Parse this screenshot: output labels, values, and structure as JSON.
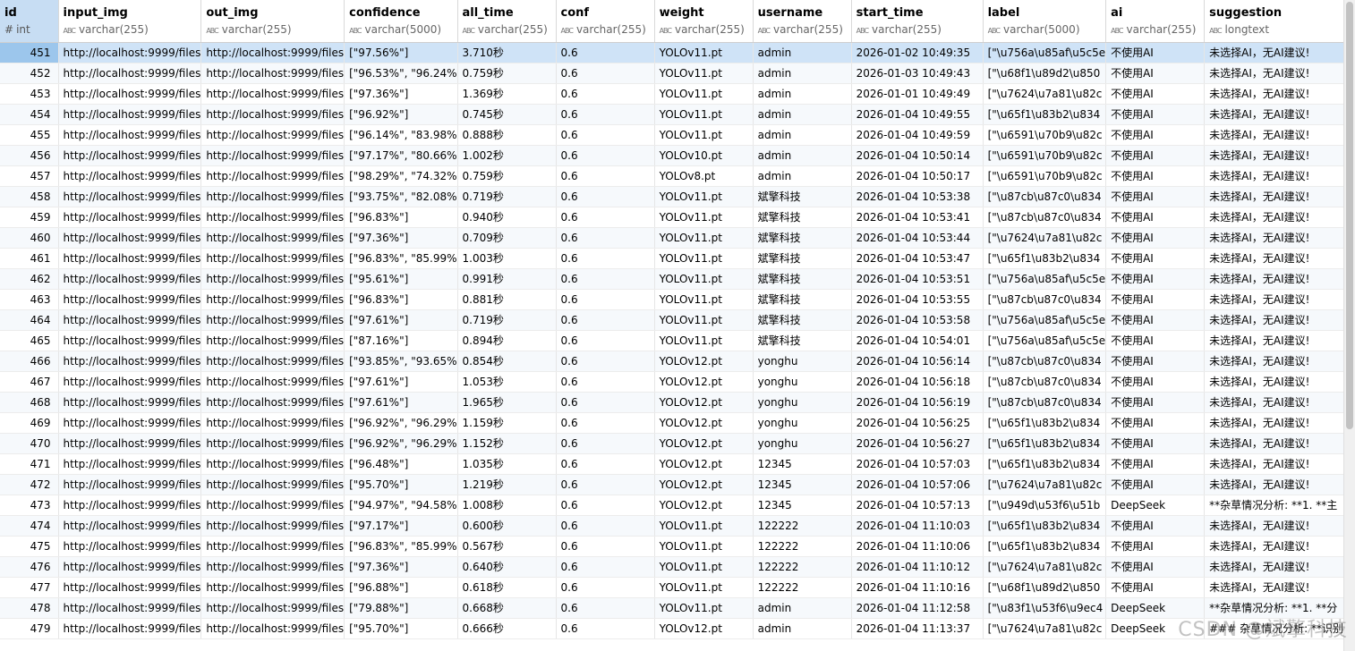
{
  "columns": [
    {
      "name": "id",
      "type": "int",
      "icon": "#",
      "width": 72
    },
    {
      "name": "input_img",
      "type": "varchar(255)",
      "icon": "ABC",
      "width": 151
    },
    {
      "name": "out_img",
      "type": "varchar(255)",
      "icon": "ABC",
      "width": 151
    },
    {
      "name": "confidence",
      "type": "varchar(5000)",
      "icon": "ABC",
      "width": 118
    },
    {
      "name": "all_time",
      "type": "varchar(255)",
      "icon": "ABC",
      "width": 112
    },
    {
      "name": "conf",
      "type": "varchar(255)",
      "icon": "ABC",
      "width": 112
    },
    {
      "name": "weight",
      "type": "varchar(255)",
      "icon": "ABC",
      "width": 112
    },
    {
      "name": "username",
      "type": "varchar(255)",
      "icon": "ABC",
      "width": 112
    },
    {
      "name": "start_time",
      "type": "varchar(255)",
      "icon": "ABC",
      "width": 150
    },
    {
      "name": "label",
      "type": "varchar(5000)",
      "icon": "ABC",
      "width": 130
    },
    {
      "name": "ai",
      "type": "varchar(255)",
      "icon": "ABC",
      "width": 112
    },
    {
      "name": "suggestion",
      "type": "longtext",
      "icon": "ABC",
      "width": 150
    }
  ],
  "rows": [
    [
      "451",
      "http://localhost:9999/files",
      "http://localhost:9999/files",
      "[\"97.56%\"]",
      "3.710秒",
      "0.6",
      "YOLOv11.pt",
      "admin",
      "2026-01-02 10:49:35",
      "[\"\\u756a\\u85af\\u5c5e",
      "不使用AI",
      "未选择AI，无AI建议!"
    ],
    [
      "452",
      "http://localhost:9999/files",
      "http://localhost:9999/files",
      "[\"96.53%\", \"96.24%",
      "0.759秒",
      "0.6",
      "YOLOv11.pt",
      "admin",
      "2026-01-03 10:49:43",
      "[\"\\u68f1\\u89d2\\u850",
      "不使用AI",
      "未选择AI，无AI建议!"
    ],
    [
      "453",
      "http://localhost:9999/files",
      "http://localhost:9999/files",
      "[\"97.36%\"]",
      "1.369秒",
      "0.6",
      "YOLOv11.pt",
      "admin",
      "2026-01-01 10:49:49",
      "[\"\\u7624\\u7a81\\u82c",
      "不使用AI",
      "未选择AI，无AI建议!"
    ],
    [
      "454",
      "http://localhost:9999/files",
      "http://localhost:9999/files",
      "[\"96.92%\"]",
      "0.745秒",
      "0.6",
      "YOLOv11.pt",
      "admin",
      "2026-01-04 10:49:55",
      "[\"\\u65f1\\u83b2\\u834",
      "不使用AI",
      "未选择AI，无AI建议!"
    ],
    [
      "455",
      "http://localhost:9999/files",
      "http://localhost:9999/files",
      "[\"96.14%\", \"83.98%",
      "0.888秒",
      "0.6",
      "YOLOv11.pt",
      "admin",
      "2026-01-04 10:49:59",
      "[\"\\u6591\\u70b9\\u82c",
      "不使用AI",
      "未选择AI，无AI建议!"
    ],
    [
      "456",
      "http://localhost:9999/files",
      "http://localhost:9999/files",
      "[\"97.17%\", \"80.66%",
      "1.002秒",
      "0.6",
      "YOLOv10.pt",
      "admin",
      "2026-01-04 10:50:14",
      "[\"\\u6591\\u70b9\\u82c",
      "不使用AI",
      "未选择AI，无AI建议!"
    ],
    [
      "457",
      "http://localhost:9999/files",
      "http://localhost:9999/files",
      "[\"98.29%\", \"74.32%",
      "0.759秒",
      "0.6",
      "YOLOv8.pt",
      "admin",
      "2026-01-04 10:50:17",
      "[\"\\u6591\\u70b9\\u82c",
      "不使用AI",
      "未选择AI，无AI建议!"
    ],
    [
      "458",
      "http://localhost:9999/files",
      "http://localhost:9999/files",
      "[\"93.75%\", \"82.08%",
      "0.719秒",
      "0.6",
      "YOLOv11.pt",
      "斌擎科技",
      "2026-01-04 10:53:38",
      "[\"\\u87cb\\u87c0\\u834",
      "不使用AI",
      "未选择AI，无AI建议!"
    ],
    [
      "459",
      "http://localhost:9999/files",
      "http://localhost:9999/files",
      "[\"96.83%\"]",
      "0.940秒",
      "0.6",
      "YOLOv11.pt",
      "斌擎科技",
      "2026-01-04 10:53:41",
      "[\"\\u87cb\\u87c0\\u834",
      "不使用AI",
      "未选择AI，无AI建议!"
    ],
    [
      "460",
      "http://localhost:9999/files",
      "http://localhost:9999/files",
      "[\"97.36%\"]",
      "0.709秒",
      "0.6",
      "YOLOv11.pt",
      "斌擎科技",
      "2026-01-04 10:53:44",
      "[\"\\u7624\\u7a81\\u82c",
      "不使用AI",
      "未选择AI，无AI建议!"
    ],
    [
      "461",
      "http://localhost:9999/files",
      "http://localhost:9999/files",
      "[\"96.83%\", \"85.99%",
      "1.003秒",
      "0.6",
      "YOLOv11.pt",
      "斌擎科技",
      "2026-01-04 10:53:47",
      "[\"\\u65f1\\u83b2\\u834",
      "不使用AI",
      "未选择AI，无AI建议!"
    ],
    [
      "462",
      "http://localhost:9999/files",
      "http://localhost:9999/files",
      "[\"95.61%\"]",
      "0.991秒",
      "0.6",
      "YOLOv11.pt",
      "斌擎科技",
      "2026-01-04 10:53:51",
      "[\"\\u756a\\u85af\\u5c5e",
      "不使用AI",
      "未选择AI，无AI建议!"
    ],
    [
      "463",
      "http://localhost:9999/files",
      "http://localhost:9999/files",
      "[\"96.83%\"]",
      "0.881秒",
      "0.6",
      "YOLOv11.pt",
      "斌擎科技",
      "2026-01-04 10:53:55",
      "[\"\\u87cb\\u87c0\\u834",
      "不使用AI",
      "未选择AI，无AI建议!"
    ],
    [
      "464",
      "http://localhost:9999/files",
      "http://localhost:9999/files",
      "[\"97.61%\"]",
      "0.719秒",
      "0.6",
      "YOLOv11.pt",
      "斌擎科技",
      "2026-01-04 10:53:58",
      "[\"\\u756a\\u85af\\u5c5e",
      "不使用AI",
      "未选择AI，无AI建议!"
    ],
    [
      "465",
      "http://localhost:9999/files",
      "http://localhost:9999/files",
      "[\"87.16%\"]",
      "0.894秒",
      "0.6",
      "YOLOv11.pt",
      "斌擎科技",
      "2026-01-04 10:54:01",
      "[\"\\u756a\\u85af\\u5c5e",
      "不使用AI",
      "未选择AI，无AI建议!"
    ],
    [
      "466",
      "http://localhost:9999/files",
      "http://localhost:9999/files",
      "[\"93.85%\", \"93.65%",
      "0.854秒",
      "0.6",
      "YOLOv12.pt",
      "yonghu",
      "2026-01-04 10:56:14",
      "[\"\\u87cb\\u87c0\\u834",
      "不使用AI",
      "未选择AI，无AI建议!"
    ],
    [
      "467",
      "http://localhost:9999/files",
      "http://localhost:9999/files",
      "[\"97.61%\"]",
      "1.053秒",
      "0.6",
      "YOLOv12.pt",
      "yonghu",
      "2026-01-04 10:56:18",
      "[\"\\u87cb\\u87c0\\u834",
      "不使用AI",
      "未选择AI，无AI建议!"
    ],
    [
      "468",
      "http://localhost:9999/files",
      "http://localhost:9999/files",
      "[\"97.61%\"]",
      "1.965秒",
      "0.6",
      "YOLOv12.pt",
      "yonghu",
      "2026-01-04 10:56:19",
      "[\"\\u87cb\\u87c0\\u834",
      "不使用AI",
      "未选择AI，无AI建议!"
    ],
    [
      "469",
      "http://localhost:9999/files",
      "http://localhost:9999/files",
      "[\"96.92%\", \"96.29%",
      "1.159秒",
      "0.6",
      "YOLOv12.pt",
      "yonghu",
      "2026-01-04 10:56:25",
      "[\"\\u65f1\\u83b2\\u834",
      "不使用AI",
      "未选择AI，无AI建议!"
    ],
    [
      "470",
      "http://localhost:9999/files",
      "http://localhost:9999/files",
      "[\"96.92%\", \"96.29%",
      "1.152秒",
      "0.6",
      "YOLOv12.pt",
      "yonghu",
      "2026-01-04 10:56:27",
      "[\"\\u65f1\\u83b2\\u834",
      "不使用AI",
      "未选择AI，无AI建议!"
    ],
    [
      "471",
      "http://localhost:9999/files",
      "http://localhost:9999/files",
      "[\"96.48%\"]",
      "1.035秒",
      "0.6",
      "YOLOv12.pt",
      "12345",
      "2026-01-04 10:57:03",
      "[\"\\u65f1\\u83b2\\u834",
      "不使用AI",
      "未选择AI，无AI建议!"
    ],
    [
      "472",
      "http://localhost:9999/files",
      "http://localhost:9999/files",
      "[\"95.70%\"]",
      "1.219秒",
      "0.6",
      "YOLOv12.pt",
      "12345",
      "2026-01-04 10:57:06",
      "[\"\\u7624\\u7a81\\u82c",
      "不使用AI",
      "未选择AI，无AI建议!"
    ],
    [
      "473",
      "http://localhost:9999/files",
      "http://localhost:9999/files",
      "[\"94.97%\", \"94.58%",
      "1.008秒",
      "0.6",
      "YOLOv12.pt",
      "12345",
      "2026-01-04 10:57:13",
      "[\"\\u949d\\u53f6\\u51b",
      "DeepSeek",
      "**杂草情况分析: **1. **主"
    ],
    [
      "474",
      "http://localhost:9999/files",
      "http://localhost:9999/files",
      "[\"97.17%\"]",
      "0.600秒",
      "0.6",
      "YOLOv11.pt",
      "122222",
      "2026-01-04 11:10:03",
      "[\"\\u65f1\\u83b2\\u834",
      "不使用AI",
      "未选择AI，无AI建议!"
    ],
    [
      "475",
      "http://localhost:9999/files",
      "http://localhost:9999/files",
      "[\"96.83%\", \"85.99%",
      "0.567秒",
      "0.6",
      "YOLOv11.pt",
      "122222",
      "2026-01-04 11:10:06",
      "[\"\\u65f1\\u83b2\\u834",
      "不使用AI",
      "未选择AI，无AI建议!"
    ],
    [
      "476",
      "http://localhost:9999/files",
      "http://localhost:9999/files",
      "[\"97.36%\"]",
      "0.640秒",
      "0.6",
      "YOLOv11.pt",
      "122222",
      "2026-01-04 11:10:12",
      "[\"\\u7624\\u7a81\\u82c",
      "不使用AI",
      "未选择AI，无AI建议!"
    ],
    [
      "477",
      "http://localhost:9999/files",
      "http://localhost:9999/files",
      "[\"96.88%\"]",
      "0.618秒",
      "0.6",
      "YOLOv11.pt",
      "122222",
      "2026-01-04 11:10:16",
      "[\"\\u68f1\\u89d2\\u850",
      "不使用AI",
      "未选择AI，无AI建议!"
    ],
    [
      "478",
      "http://localhost:9999/files",
      "http://localhost:9999/files",
      "[\"79.88%\"]",
      "0.668秒",
      "0.6",
      "YOLOv11.pt",
      "admin",
      "2026-01-04 11:12:58",
      "[\"\\u83f1\\u53f6\\u9ec4",
      "DeepSeek",
      "**杂草情况分析: **1. **分"
    ],
    [
      "479",
      "http://localhost:9999/files",
      "http://localhost:9999/files",
      "[\"95.70%\"]",
      "0.666秒",
      "0.6",
      "YOLOv12.pt",
      "admin",
      "2026-01-04 11:13:37",
      "[\"\\u7624\\u7a81\\u82c",
      "DeepSeek",
      "### 杂草情况分析: **识别"
    ]
  ],
  "selected_row": 0,
  "watermark": "CSDN @斌擎科技"
}
